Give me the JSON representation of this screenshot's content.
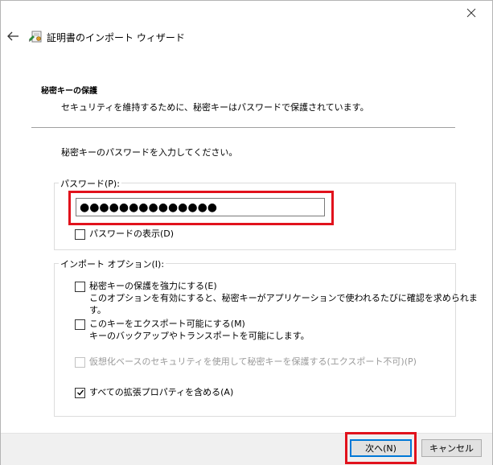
{
  "wizard": {
    "title": "証明書のインポート ウィザード"
  },
  "section": {
    "heading": "秘密キーの保護",
    "subtitle": "セキュリティを維持するために、秘密キーはパスワードで保護されています。"
  },
  "prompt": "秘密キーのパスワードを入力してください。",
  "password_group": {
    "label": "パスワード(P):",
    "value": "●●●●●●●●●●●●●●",
    "show_password_label": "パスワードの表示(D)",
    "show_password_checked": false
  },
  "import_options": {
    "label": "インポート オプション(I):",
    "strong_protection": {
      "label": "秘密キーの保護を強力にする(E)",
      "description": "このオプションを有効にすると、秘密キーがアプリケーションで使われるたびに確認を求められます。",
      "checked": false
    },
    "exportable": {
      "label": "このキーをエクスポート可能にする(M)",
      "description": "キーのバックアップやトランスポートを可能にします。",
      "checked": false
    },
    "virtualization": {
      "label": "仮想化ベースのセキュリティを使用して秘密キーを保護する(エクスポート不可)(P)",
      "checked": false,
      "disabled": true
    },
    "extended_properties": {
      "label": "すべての拡張プロパティを含める(A)",
      "checked": true
    }
  },
  "buttons": {
    "next": "次へ(N)",
    "cancel": "キャンセル"
  },
  "colors": {
    "highlight": "#e1121c",
    "focus": "#0078d7"
  },
  "icons": {
    "close": "close-icon",
    "back": "back-arrow-icon",
    "wizard": "certificate-wizard-icon",
    "check": "check-icon"
  }
}
